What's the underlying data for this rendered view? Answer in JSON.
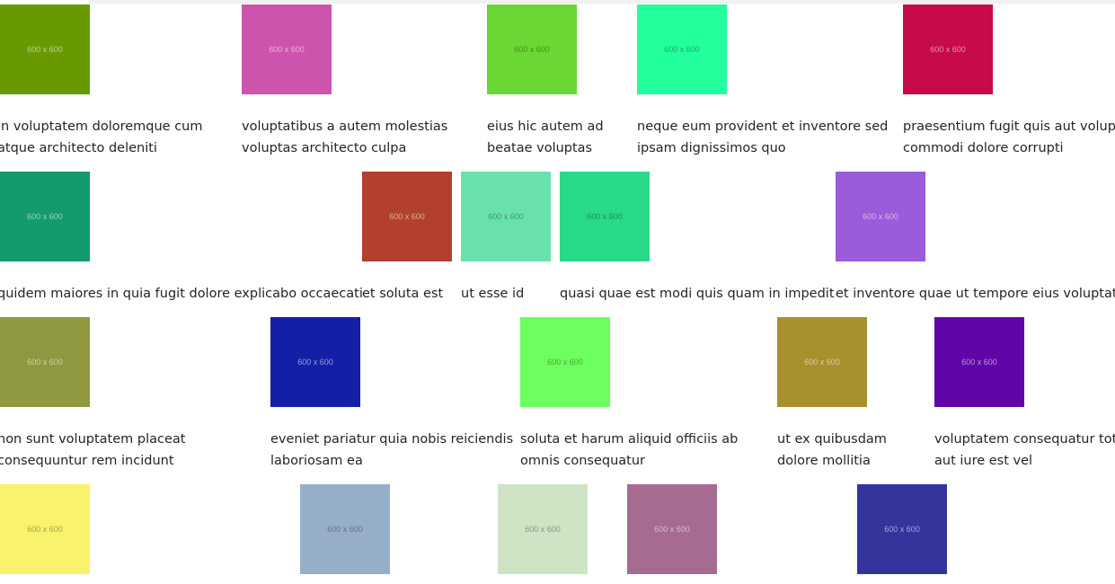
{
  "gallery": {
    "items": [
      {
        "color": "#689900",
        "placeholder": "600 x 600",
        "lines": [
          "in voluptatem doloremque cum",
          "atque architecto deleniti"
        ]
      },
      {
        "color": "#cc54ad",
        "placeholder": "600 x 600",
        "lines": [
          "voluptatibus a autem molestias",
          "voluptas architecto culpa"
        ]
      },
      {
        "color": "#6ad734",
        "placeholder": "600 x 600",
        "lines": [
          "eius hic autem ad",
          "beatae voluptas"
        ]
      },
      {
        "color": "#24ff9d",
        "placeholder": "600 x 600",
        "lines": [
          "neque eum provident et inventore sed",
          "ipsam dignissimos quo"
        ]
      },
      {
        "color": "#c60a4a",
        "placeholder": "600 x 600",
        "lines": [
          "praesentium fugit quis aut volupta",
          "commodi dolore corrupti"
        ]
      },
      {
        "color": "#149b6b",
        "placeholder": "600 x 600",
        "lines": [
          "quidem maiores in quia fugit dolore explicabo occaecati"
        ]
      },
      {
        "color": "#b3402e",
        "placeholder": "600 x 600",
        "lines": [
          "et soluta est"
        ]
      },
      {
        "color": "#68e2aa",
        "placeholder": "600 x 600",
        "lines": [
          "ut esse id"
        ]
      },
      {
        "color": "#29d98a",
        "placeholder": "600 x 600",
        "lines": [
          "quasi quae est modi quis quam in impedit"
        ]
      },
      {
        "color": "#9c5bda",
        "placeholder": "600 x 600",
        "lines": [
          "et inventore quae ut tempore eius voluptatu"
        ]
      },
      {
        "color": "#8f983e",
        "placeholder": "600 x 600",
        "lines": [
          "non sunt voluptatem placeat",
          "consequuntur rem incidunt"
        ]
      },
      {
        "color": "#141fa8",
        "placeholder": "600 x 600",
        "lines": [
          "eveniet pariatur quia nobis reiciendis",
          "laboriosam ea"
        ]
      },
      {
        "color": "#6dff5d",
        "placeholder": "600 x 600",
        "lines": [
          "soluta et harum aliquid officiis ab",
          "omnis consequatur"
        ]
      },
      {
        "color": "#a9902e",
        "placeholder": "600 x 600",
        "lines": [
          "ut ex quibusdam",
          "dolore mollitia"
        ]
      },
      {
        "color": "#6006a8",
        "placeholder": "600 x 600",
        "lines": [
          "voluptatem consequatur tota",
          "aut iure est vel"
        ]
      },
      {
        "color": "#f9f26d",
        "placeholder": "600 x 600",
        "lines": []
      },
      {
        "color": "#97aecb",
        "placeholder": "600 x 600",
        "lines": []
      },
      {
        "color": "#cee4c5",
        "placeholder": "600 x 600",
        "lines": []
      },
      {
        "color": "#a56b91",
        "placeholder": "600 x 600",
        "lines": []
      },
      {
        "color": "#34349c",
        "placeholder": "600 x 600",
        "lines": []
      }
    ]
  }
}
